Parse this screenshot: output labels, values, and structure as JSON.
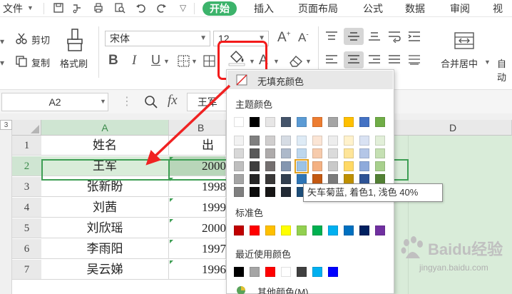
{
  "menubar": {
    "file_label": "文件",
    "tabs": [
      {
        "label": "开始",
        "active": true
      },
      {
        "label": "插入",
        "active": false
      },
      {
        "label": "页面布局",
        "active": false
      },
      {
        "label": "公式",
        "active": false
      },
      {
        "label": "数据",
        "active": false
      },
      {
        "label": "审阅",
        "active": false
      },
      {
        "label": "视图",
        "active": false
      }
    ]
  },
  "ribbon": {
    "cut_label": "剪切",
    "copy_label": "复制",
    "format_painter_label": "格式刷",
    "font_name": "宋体",
    "font_size": "12",
    "bold": "B",
    "italic": "I",
    "underline": "U",
    "font_color_letter": "A",
    "increase_font": "A+",
    "decrease_font": "A-",
    "merge_center_label": "合并居中",
    "auto_wrap_label": "自动"
  },
  "formula_bar": {
    "name_box": "A2",
    "fx": "fx",
    "content": "王军"
  },
  "sheet": {
    "corner_label": "3",
    "columns": [
      "A",
      "B",
      "C",
      "D"
    ],
    "rows": [
      {
        "num": "1",
        "a": "姓名",
        "b": "出生"
      },
      {
        "num": "2",
        "a": "王军",
        "b": "2000"
      },
      {
        "num": "3",
        "a": "张新盼",
        "b": "1998"
      },
      {
        "num": "4",
        "a": "刘茜",
        "b": "1999"
      },
      {
        "num": "5",
        "a": "刘欣瑶",
        "b": "2000"
      },
      {
        "num": "6",
        "a": "李雨阳",
        "b": "1997"
      },
      {
        "num": "7",
        "a": "吴云娣",
        "b": "1996"
      }
    ]
  },
  "fill_dropdown": {
    "no_fill_label": "无填充颜色",
    "theme_colors_label": "主题颜色",
    "standard_colors_label": "标准色",
    "recent_colors_label": "最近使用颜色",
    "more_colors_label": "其他颜色(M)...",
    "theme_colors": [
      "#ffffff",
      "#000000",
      "#e7e6e6",
      "#44546a",
      "#5b9bd5",
      "#ed7d31",
      "#a5a5a5",
      "#ffc000",
      "#4472c4",
      "#70ad47"
    ],
    "theme_shades": [
      [
        "#f2f2f2",
        "#7f7f7f",
        "#d0cece",
        "#d6dce4",
        "#deebf6",
        "#fbe5d5",
        "#ededed",
        "#fff2cc",
        "#d9e2f3",
        "#e2efd9"
      ],
      [
        "#d8d8d8",
        "#595959",
        "#aeabab",
        "#adb9ca",
        "#bdd7ee",
        "#f7cbac",
        "#dbdbdb",
        "#fee599",
        "#b4c6e7",
        "#c5e0b3"
      ],
      [
        "#bfbfbf",
        "#3f3f3f",
        "#757070",
        "#8496b0",
        "#9cc3e5",
        "#f4b183",
        "#c9c9c9",
        "#ffd965",
        "#8eaadb",
        "#a8d08d"
      ],
      [
        "#a5a5a5",
        "#262626",
        "#3a3838",
        "#323f4f",
        "#2e75b5",
        "#c45911",
        "#7b7b7b",
        "#bf9000",
        "#2f5496",
        "#538135"
      ],
      [
        "#7f7f7f",
        "#0c0c0c",
        "#171616",
        "#222a35",
        "#1e4e79",
        "#843c0b",
        "#525252",
        "#7f6000",
        "#1f3864",
        "#375623"
      ]
    ],
    "standard_colors": [
      "#c00000",
      "#ff0000",
      "#ffc000",
      "#ffff00",
      "#92d050",
      "#00b050",
      "#00b0f0",
      "#0070c0",
      "#002060",
      "#7030a0"
    ],
    "recent_colors": [
      "#000000",
      "#a5a5a5",
      "#ff0000",
      "#ffffff",
      "#404040",
      "#00b0f0",
      "#0000ff"
    ],
    "tooltip": "矢车菊蓝, 着色1, 浅色 40%"
  },
  "watermark": {
    "brand": "Baidu经验",
    "url": "jingyan.baidu.com"
  },
  "colors": {
    "accent_green": "#3cb36b",
    "highlight_red": "#f31b1b",
    "selection_fill": "#d9ecd9"
  }
}
